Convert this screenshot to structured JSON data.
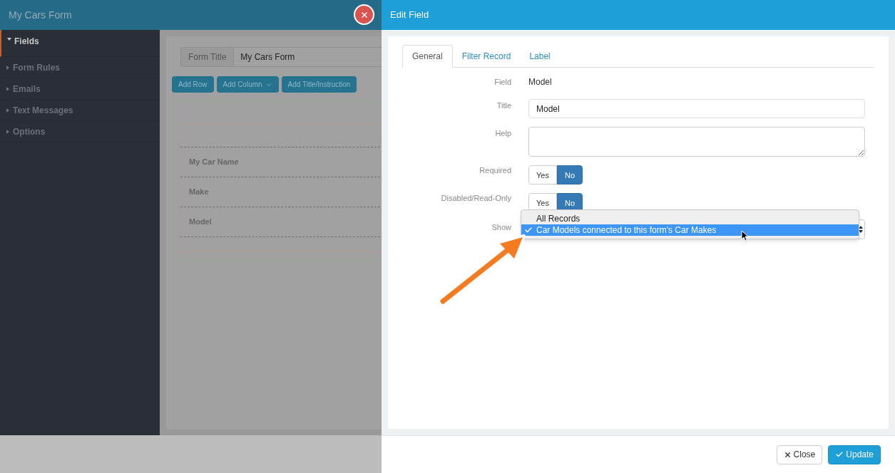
{
  "app": {
    "title": "My Cars Form"
  },
  "sidebar": {
    "items": [
      {
        "label": "Fields",
        "expanded": true,
        "selected": true
      },
      {
        "label": "Form Rules",
        "expanded": false,
        "selected": false
      },
      {
        "label": "Emails",
        "expanded": false,
        "selected": false
      },
      {
        "label": "Text Messages",
        "expanded": false,
        "selected": false
      },
      {
        "label": "Options",
        "expanded": false,
        "selected": false
      }
    ]
  },
  "form_title": {
    "label": "Form Title",
    "value": "My Cars Form"
  },
  "toolbar": [
    {
      "label": "Add Row",
      "kind": "plain"
    },
    {
      "label": "Add Column",
      "kind": "dropdown"
    },
    {
      "label": "Add Title/Instruction",
      "kind": "plain"
    }
  ],
  "form_rows": [
    "My Car Name",
    "Make",
    "Model"
  ],
  "edit_field": {
    "title": "Edit Field",
    "tabs": [
      {
        "label": "General",
        "selected": true
      },
      {
        "label": "Filter Record",
        "selected": false
      },
      {
        "label": "Label",
        "selected": false
      }
    ],
    "fields": [
      {
        "kind": "text",
        "label": "Field",
        "value": "Model"
      },
      {
        "kind": "input",
        "label": "Title",
        "value": "Model"
      },
      {
        "kind": "textarea",
        "label": "Help"
      },
      {
        "kind": "toggle",
        "label": "Required",
        "options": [
          {
            "label": "Yes",
            "selected": false
          },
          {
            "label": "No",
            "selected": true
          }
        ]
      },
      {
        "kind": "toggle",
        "label": "Disabled/Read-Only",
        "options": [
          {
            "label": "Yes",
            "selected": false
          },
          {
            "label": "No",
            "selected": true
          }
        ]
      },
      {
        "kind": "select",
        "label": "Show",
        "expanded": true,
        "options": [
          {
            "label": "All Records",
            "selected": false
          },
          {
            "label": "Car Models connected to this form's Car Makes",
            "selected": true
          }
        ]
      }
    ]
  },
  "footer": [
    {
      "label": "Close",
      "kind": "default"
    },
    {
      "label": "Update",
      "kind": "primary"
    }
  ]
}
